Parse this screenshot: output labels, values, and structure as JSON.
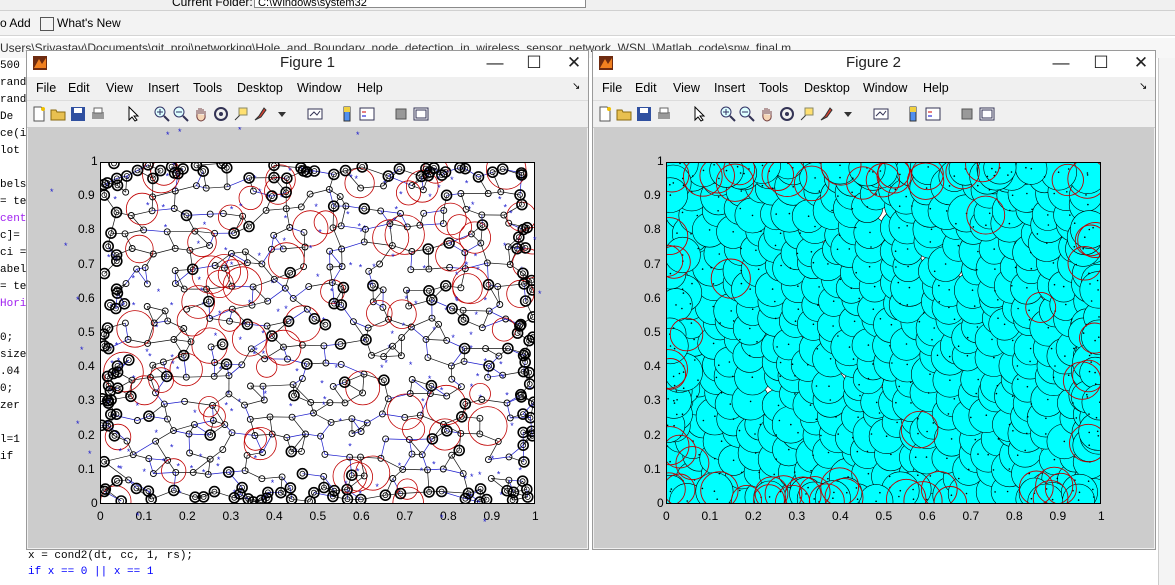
{
  "desktop": {
    "current_folder_label": "Current Folder:",
    "current_folder_value": "C:\\Windows\\system32",
    "shortcut_add": "o Add",
    "shortcut_whats_new": "What's New",
    "file_path": "Users\\Srivastav\\Documents\\git_proj\\networking\\Hole_and_Boundary_node_detection_in_wireless_sensor_network_WSN_\\Matlab_code\\snw_final.m",
    "code_lines": [
      "500",
      "rand",
      "rand",
      "  De",
      "ce(i",
      "lot",
      "",
      "bels",
      "= te",
      "cent",
      "c]=",
      "ci =",
      "abel",
      "= te",
      "Hori",
      "",
      "0;",
      "size",
      ".04",
      "0;",
      "zer",
      "",
      "l=1",
      "if"
    ],
    "code_bottom_1": "x = cond2(dt, cc, 1, rs);",
    "code_bottom_2": "if x == 0 || x == 1"
  },
  "menu_items": [
    "File",
    "Edit",
    "View",
    "Insert",
    "Tools",
    "Desktop",
    "Window",
    "Help"
  ],
  "toolbar_icons": [
    "new-file-icon",
    "open-folder-icon",
    "save-icon",
    "print-icon",
    "select-arrow-icon",
    "zoom-in-icon",
    "zoom-out-icon",
    "pan-hand-icon",
    "rotate-3d-icon",
    "data-cursor-icon",
    "brush-icon",
    "brush-dropdown-icon",
    "link-plot-icon",
    "colorbar-icon",
    "legend-icon",
    "hide-plot-tools-icon",
    "show-plot-tools-icon"
  ],
  "figure1": {
    "title": "Figure 1"
  },
  "figure2": {
    "title": "Figure 2"
  },
  "axis_ticks": {
    "x": [
      "0",
      "0.1",
      "0.2",
      "0.3",
      "0.4",
      "0.5",
      "0.6",
      "0.7",
      "0.8",
      "0.9",
      "1"
    ],
    "y": [
      "0",
      "0.1",
      "0.2",
      "0.3",
      "0.4",
      "0.5",
      "0.6",
      "0.7",
      "0.8",
      "0.9",
      "1"
    ]
  },
  "chart_data": [
    {
      "type": "scatter",
      "chart": "Figure 1",
      "xlim": [
        0,
        1
      ],
      "ylim": [
        0,
        1
      ],
      "grid": false,
      "description_of_marks": "sensor nodes (black circles), boundary nodes (bold black circles), Delaunay triangulation edges (blue/black lines), red coverage circles, blue star markers",
      "colors": {
        "node": "#000000",
        "boundary_circle": "#c00000",
        "triangulation": "#1a1acc",
        "star": "#1a1acc"
      }
    },
    {
      "type": "scatter",
      "chart": "Figure 2",
      "xlim": [
        0,
        1
      ],
      "ylim": [
        0,
        1
      ],
      "grid": false,
      "description_of_marks": "cyan filled sensing discs with black outlines covering the field, red boundary circles, white coverage holes",
      "colors": {
        "disc_fill": "#00ffff",
        "disc_edge": "#000000",
        "boundary_circle": "#c00000",
        "hole": "#ffffff"
      }
    }
  ]
}
